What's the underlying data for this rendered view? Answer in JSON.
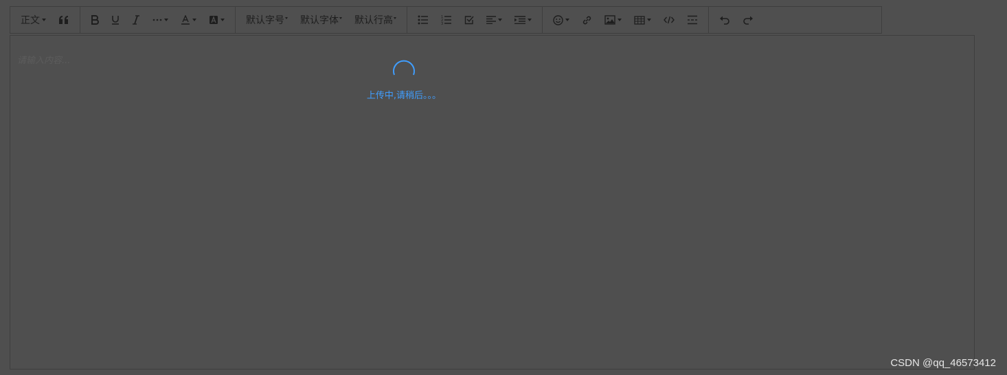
{
  "toolbar": {
    "groups": [
      [
        {
          "id": "heading",
          "label": "正文",
          "caret": true
        },
        {
          "id": "quote",
          "icon": "quote-icon"
        }
      ],
      [
        {
          "id": "bold",
          "icon": "bold-icon"
        },
        {
          "id": "underline",
          "icon": "underline-icon"
        },
        {
          "id": "italic",
          "icon": "italic-icon"
        },
        {
          "id": "more",
          "icon": "more-icon",
          "caret": true
        },
        {
          "id": "font-color",
          "icon": "font-color-icon",
          "caret": true
        },
        {
          "id": "bg-color",
          "icon": "bg-color-icon",
          "caret": true
        }
      ],
      [
        {
          "id": "font-size",
          "label": "默认字号",
          "caret": true
        },
        {
          "id": "font-family",
          "label": "默认字体",
          "caret": true
        },
        {
          "id": "line-height",
          "label": "默认行高",
          "caret": true
        }
      ],
      [
        {
          "id": "bulleted-list",
          "icon": "bulleted-list-icon"
        },
        {
          "id": "numbered-list",
          "icon": "numbered-list-icon"
        },
        {
          "id": "todo",
          "icon": "checkbox-icon"
        },
        {
          "id": "justify",
          "icon": "align-left-icon",
          "caret": true
        },
        {
          "id": "indent",
          "icon": "indent-icon",
          "caret": true
        }
      ],
      [
        {
          "id": "emotion",
          "icon": "emoji-icon",
          "caret": true
        },
        {
          "id": "link",
          "icon": "link-icon"
        },
        {
          "id": "image",
          "icon": "image-icon",
          "caret": true
        },
        {
          "id": "table",
          "icon": "table-icon",
          "caret": true
        },
        {
          "id": "code",
          "icon": "code-icon"
        },
        {
          "id": "divider",
          "icon": "divider-icon"
        }
      ],
      [
        {
          "id": "undo",
          "icon": "undo-icon"
        },
        {
          "id": "redo",
          "icon": "redo-icon"
        }
      ]
    ]
  },
  "editor": {
    "placeholder": "请输入内容..."
  },
  "loading": {
    "text": "上传中,请稍后。。。",
    "color": "#409eff"
  },
  "watermark": "CSDN @qq_46573412"
}
